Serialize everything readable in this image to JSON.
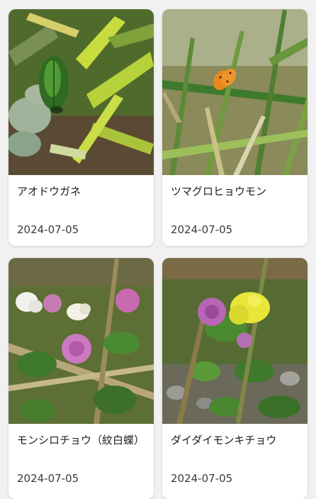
{
  "cards": [
    {
      "name": "アオドウガネ",
      "date": "2024-07-05",
      "photo_icon": "beetle-on-moss-photo"
    },
    {
      "name": "ツマグロヒョウモン",
      "date": "2024-07-05",
      "photo_icon": "orange-butterfly-in-grass-photo"
    },
    {
      "name": "モンシロチョウ（紋白蝶）",
      "date": "2024-07-05",
      "photo_icon": "white-butterfly-on-clover-photo"
    },
    {
      "name": "ダイダイモンキチョウ",
      "date": "2024-07-05",
      "photo_icon": "yellow-butterfly-on-clover-photo"
    }
  ],
  "colors": {
    "background": "#f1f1f2",
    "card": "#ffffff",
    "text": "#1d1d1d"
  }
}
